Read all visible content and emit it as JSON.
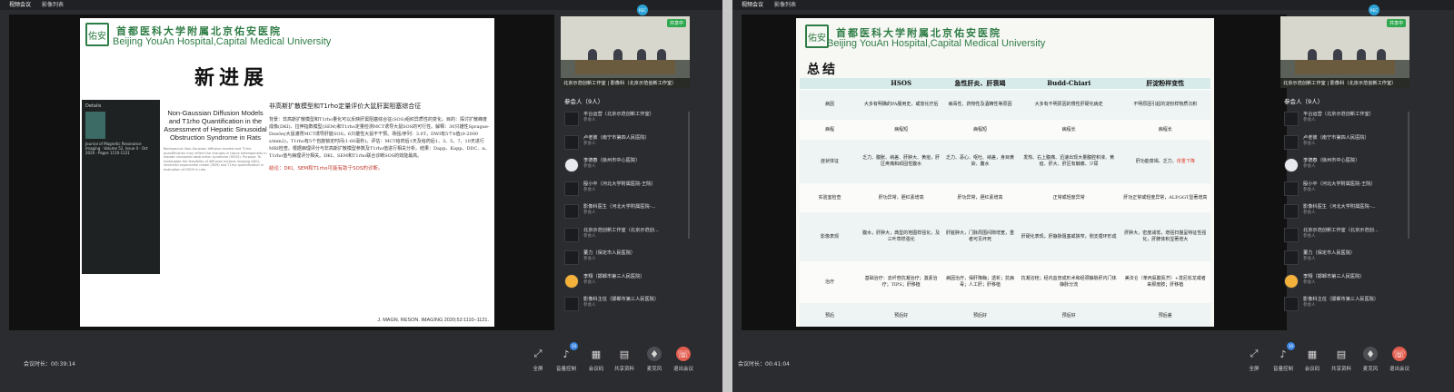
{
  "tabs": [
    "视频会议",
    "影像列表"
  ],
  "hospital": {
    "logo_char": "佑安",
    "name_cn": "首都医科大学附属北京佑安医院",
    "name_en": "Beijing YouAn Hospital,Capital Medical University"
  },
  "video": {
    "sharing_tag": "共享中",
    "caption": "北京示范创新工作室 | 影像科（北京示范创新工作室）",
    "rec_label": "REC"
  },
  "participants_header": "参会人（9人）",
  "participants": [
    {
      "name": "平台运营（北京示范创新工作室）",
      "role": "参会人"
    },
    {
      "name": "卢老彼（南宁市第四人民医院）",
      "role": "参会人"
    },
    {
      "name": "李德春（徐州市中心医院）",
      "role": "参会人"
    },
    {
      "name": "殷小平（河北大学附属医院-王院）",
      "role": "参会人"
    },
    {
      "name": "影像科医生（河北大学附属医院-...",
      "role": "参会人"
    },
    {
      "name": "北京示范创新工作室（北京示范创...",
      "role": "参会人"
    },
    {
      "name": "董力（保定市人民医院）",
      "role": "参会人"
    },
    {
      "name": "李翔（邯郸市第三人民医院）",
      "role": "参会人"
    },
    {
      "name": "影像科主任（邯郸市第三人民医院）",
      "role": "参会人"
    }
  ],
  "controls": {
    "fullscreen": "全屏",
    "volume": "音量控制",
    "volume_badge": "10",
    "meeting": "会议码",
    "share": "共享资料",
    "mic": "麦克风",
    "leave": "退出会议"
  },
  "duration_label": "会议时长：",
  "window1": {
    "duration": "00:39:14",
    "slide": {
      "title": "新进展",
      "journal_label": "Details",
      "journal_text": "Journal of Magnetic Resonance Imaging · Volume 52, Issue 4 · Oct 2020 · Pages 1110-1121",
      "paper_title": "Non-Gaussian Diffusion Models and T1rho Quantification in the Assessment of Hepatic Sinusoidal Obstruction Syndrome in Rats",
      "paper_body": "Background: Non-Gaussian diffusion models and T1rho quantification may reflect the changes in tissue heterogeneity in hepatic sinusoidal obstruction syndrome (HSOS). Purpose: To investigate the feasibility of diffusion kurtosis imaging (DKI), stretched exponential model (SEM) and T1rho quantification in evaluation of HSOS in rats.",
      "notes_heading": "非高斯扩散模型和T1rho定量评价大鼠肝窦阻塞综合征",
      "notes_body": "背景：非高斯扩散模型和T1rho量化可以反映肝窦阻塞综合征(SOS)组织异质性的变化。目的：探讨扩散峰度成像(DKI)、拉伸指数模型(SEM)和T1rho定量检测MCT诱导大鼠SOS的可行性。解释：30只雄性Sprague-Dawley大鼠灌胃MCT诱导肝脏SOS，6只雄性大鼠不干预。场强/序列：3.0T，DWI有5个b值(0-2000 s/mm2)，T1rho有5个自旋锁定时间(1-60毫秒)。评估：MCT给药后1天及给药后1、3、5、7、10天进行MRI检查。根据病理评分与非高斯扩散模型参数及T1rho值进行相关分析。结果：Dapp、Kapp、DDC、α、T1rho值与病理评分相关。DKI、SEM和T1rho联合诊断SOS的效能最高。",
      "notes_conclusion": "结论：DKI、SEM和T1rho可能有助于SOS的诊断。",
      "citation": "J. MAGN. RESON. IMAGING 2020;52:1110–1121."
    }
  },
  "window2": {
    "duration": "00:41:04",
    "slide": {
      "title": "总结",
      "table_headers": [
        "",
        "HSOS",
        "急性肝炎、肝衰竭",
        "Budd-Chiari",
        "肝淀粉样变性"
      ],
      "table_rows": [
        [
          "病因",
          "大多有明确的PA服用史，或放化疗后",
          "病毒性、药物性及酒精性等原因",
          "大多有不明原因的慢性肝硬化病史",
          "不明原因引起的淀粉样物质沉积"
        ],
        [
          "病程",
          "病程短",
          "病程短",
          "病程长",
          "病程长"
        ],
        [
          "症状体征",
          "乏力、腹胀、纳差、肝肿大、黄疸，肝区疼痛和顽固性腹水",
          "乏力、恶心、呕吐、纳差，身目黄染、腹水",
          "发热、右上腹痛、迅速出现大量腹腔积液、黄疸、肝大、肝区有触痛、少尿",
          "肝功能衰竭、乏力、体重下降"
        ],
        [
          "实验室检查",
          "肝功异常，胆红素增高",
          "肝功异常，胆红素增高",
          "正常或轻度异常",
          "肝功正常或轻度异常，ALP,GGT显著增高"
        ],
        [
          "影像表现",
          "腹水，肝肿大，典型的地图样强化，及三叶草样强化",
          "肝脏肿大，门脉周围间隙增宽，重者可见坏死",
          "肝硬化表现，肝静脉阻塞或狭窄，侧支循环形成",
          "肝肿大，密度减低，增强扫描呈特征性强化，肝脾体积显著增大"
        ],
        [
          "治疗",
          "基础治疗：去纤苷抗凝治疗；激素治疗；TIPS；肝移植",
          "病因治疗，保肝降酶；透析；抗病毒；人工肝；肝移植",
          "抗凝溶栓；经内血管成形术和经颈静脉肝内门体静脉分流",
          "美法仑（苯丙氨酸氮芥）+泼尼松龙或者来那度胺；肝移植"
        ],
        [
          "预后",
          "预后好",
          "预后好",
          "预后好",
          "预后差"
        ]
      ],
      "highlight_text": "体重下降"
    }
  }
}
